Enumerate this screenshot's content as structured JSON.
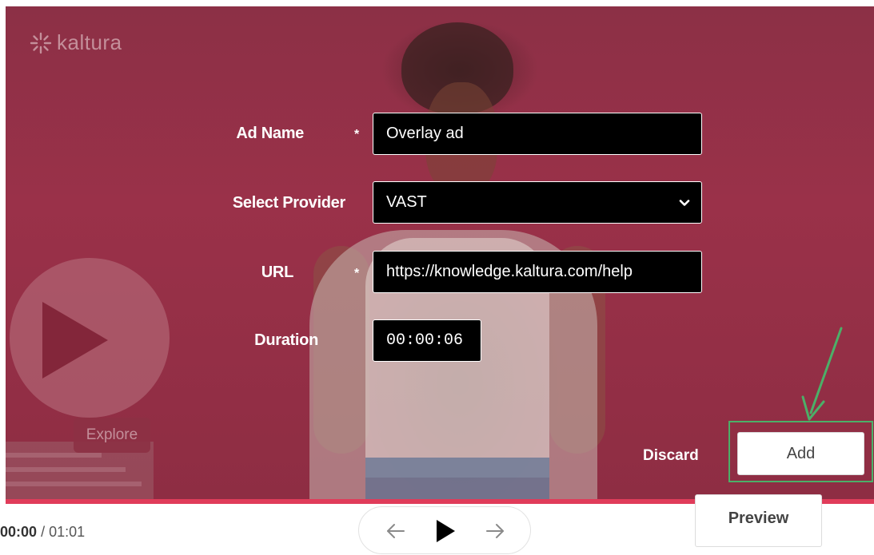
{
  "brand": {
    "logo_text": "kaltura",
    "logo_icon": "kaltura-burst-icon",
    "accent": "#e03c5a"
  },
  "video_scene": {
    "explore_text": "Explore",
    "play_icon": "play-icon"
  },
  "form": {
    "ad_name": {
      "label": "Ad Name",
      "required_mark": "*",
      "value": "Overlay ad"
    },
    "provider": {
      "label": "Select Provider",
      "value": "VAST",
      "icon": "chevron-down-icon"
    },
    "url": {
      "label": "URL",
      "required_mark": "*",
      "value": "https://knowledge.kaltura.com/help"
    },
    "duration": {
      "label": "Duration",
      "value": "00:00:06"
    }
  },
  "actions": {
    "discard_label": "Discard",
    "add_label": "Add",
    "preview_label": "Preview"
  },
  "annotation": {
    "color": "#4caf68"
  },
  "player": {
    "current_time": "00:00",
    "separator": "/",
    "total_time": "01:01",
    "prev_icon": "arrow-left-icon",
    "play_icon": "play-icon",
    "next_icon": "arrow-right-icon"
  }
}
